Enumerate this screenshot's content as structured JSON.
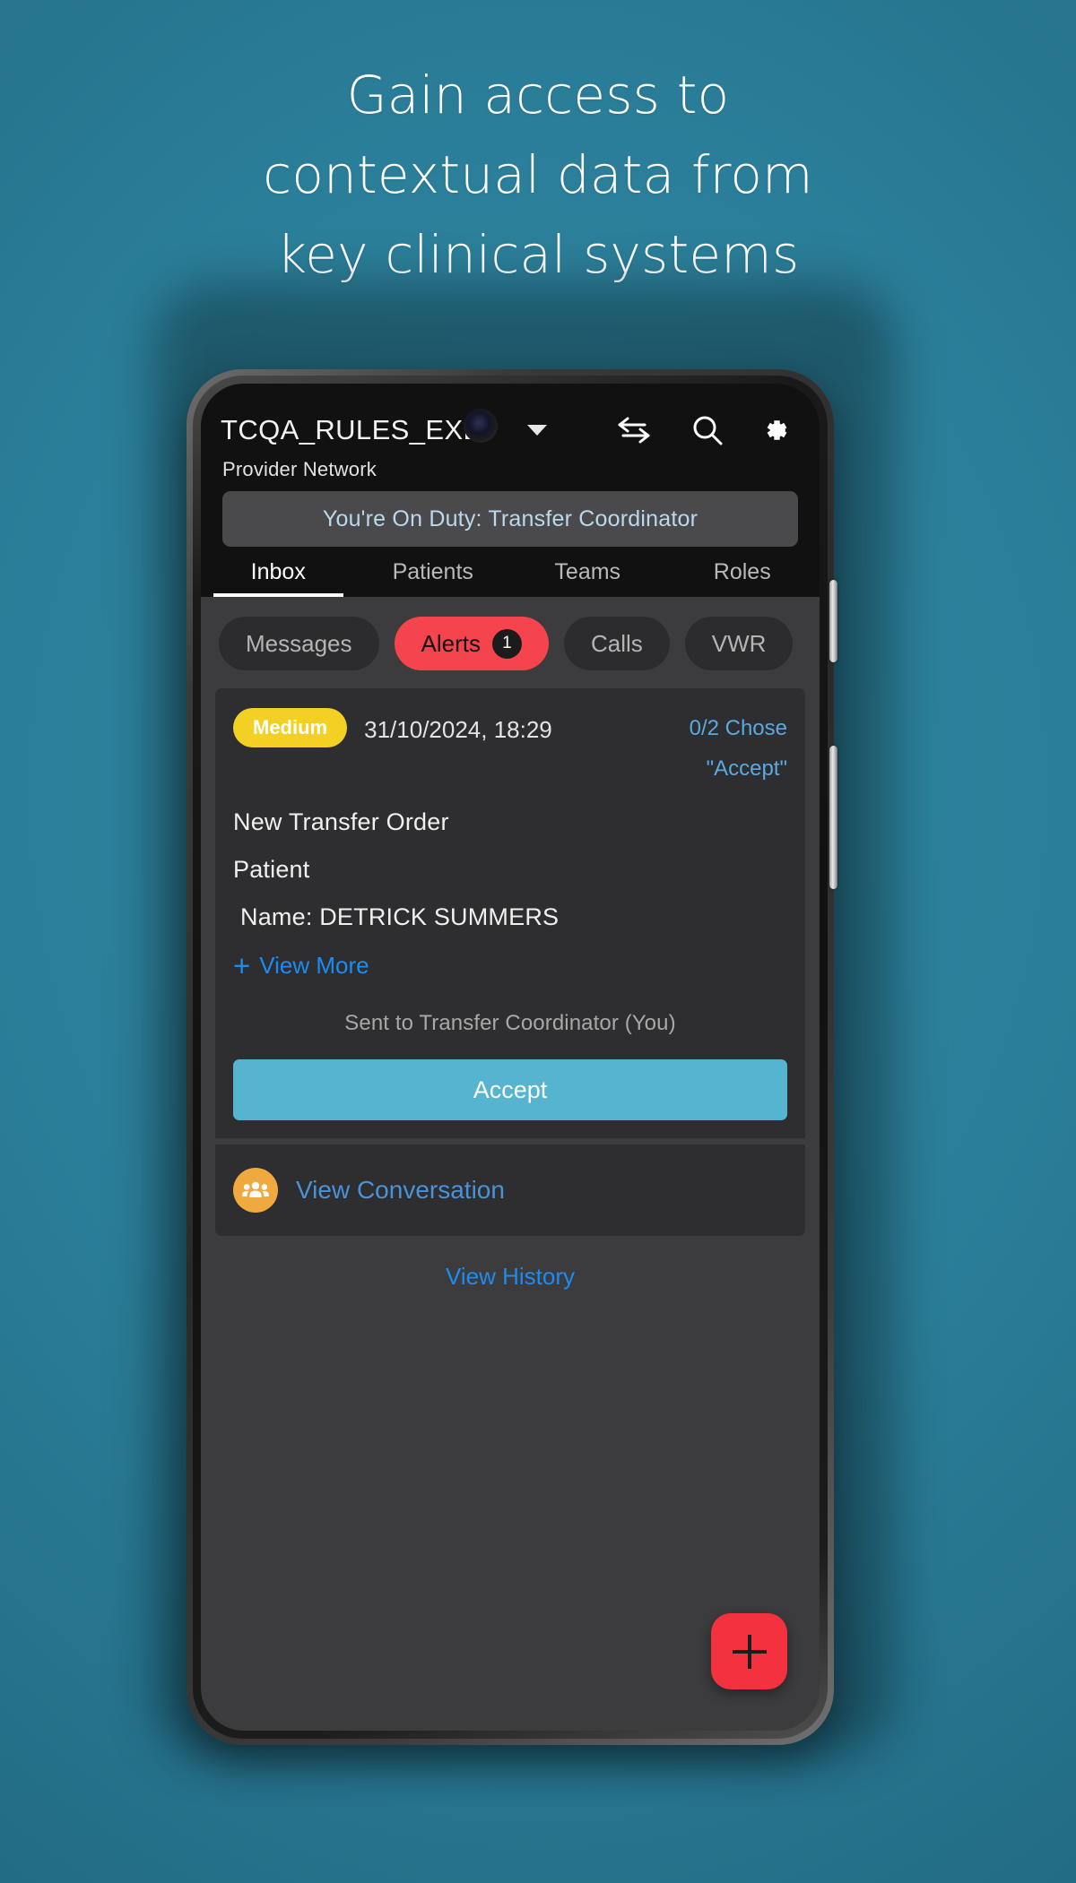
{
  "promo": {
    "headline_lines": [
      "Gain access to",
      "contextual data from",
      "key clinical systems"
    ]
  },
  "app": {
    "title": "TCQA_RULES_EXECU",
    "subtitle": "Provider Network",
    "duty_banner": "You're On Duty: Transfer Coordinator",
    "header_icons": [
      {
        "name": "transfer-arrows-icon"
      },
      {
        "name": "search-icon"
      },
      {
        "name": "settings-gear-icon"
      }
    ],
    "tabs": [
      {
        "label": "Inbox",
        "active": true
      },
      {
        "label": "Patients",
        "active": false
      },
      {
        "label": "Teams",
        "active": false
      },
      {
        "label": "Roles",
        "active": false
      }
    ],
    "chips": [
      {
        "label": "Messages",
        "active": false,
        "badge": ""
      },
      {
        "label": "Alerts",
        "active": true,
        "badge": "1"
      },
      {
        "label": "Calls",
        "active": false,
        "badge": ""
      },
      {
        "label": "VWR",
        "active": false,
        "badge": ""
      }
    ]
  },
  "alert_card": {
    "severity": "Medium",
    "timestamp": "31/10/2024, 18:29",
    "chose_line1": "0/2 Chose",
    "chose_line2": "\"Accept\"",
    "title": "New Transfer Order",
    "section": "Patient",
    "patient_name": "Name: DETRICK SUMMERS",
    "view_more_label": "View More",
    "view_more_plus": "+",
    "sent_to": "Sent to Transfer Coordinator (You)",
    "accept_label": "Accept",
    "view_conversation_label": "View Conversation",
    "conversation_icon": "group-people-icon"
  },
  "list": {
    "view_history_label": "View History"
  },
  "fab": {
    "name": "add-new-button",
    "icon": "plus-icon"
  },
  "colors": {
    "background_teal": "#2b7e99",
    "accent_red": "#f5444e",
    "accept_blue": "#55b4cf",
    "severity_yellow": "#f2d024",
    "link_blue": "#1e8bf0",
    "conversation_orange": "#f0a93f"
  }
}
